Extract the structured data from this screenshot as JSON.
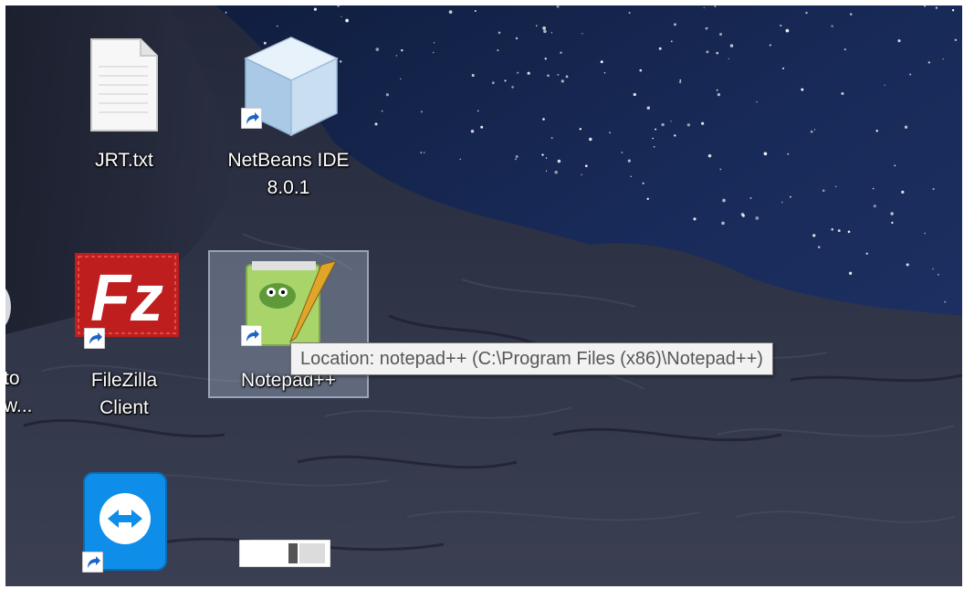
{
  "desktop": {
    "icons": [
      {
        "label": "JRT.txt",
        "icon": "text-file-icon"
      },
      {
        "label": "NetBeans IDE\n8.0.1",
        "icon": "netbeans-cube-icon",
        "shortcut": true
      },
      {
        "label": "FileZilla\nClient",
        "icon": "filezilla-icon",
        "shortcut": true
      },
      {
        "label": "Notepad++",
        "icon": "notepad-plus-plus-icon",
        "shortcut": true,
        "selected": true
      },
      {
        "label": "",
        "icon": "teamviewer-icon",
        "shortcut": true
      },
      {
        "label": "",
        "icon": "application-window-icon"
      }
    ],
    "partial_left_label": "to\nw..."
  },
  "tooltip": {
    "text": "Location: notepad++ (C:\\Program Files (x86)\\Notepad++)"
  },
  "colors": {
    "sky": "#16244a",
    "rock": "#2d3245",
    "tooltip_bg": "#f2f2f2",
    "tooltip_border": "#767676",
    "filezilla_red": "#bf1e1e",
    "teamviewer_blue": "#0e8ee9",
    "selection": "#aab9cd"
  }
}
